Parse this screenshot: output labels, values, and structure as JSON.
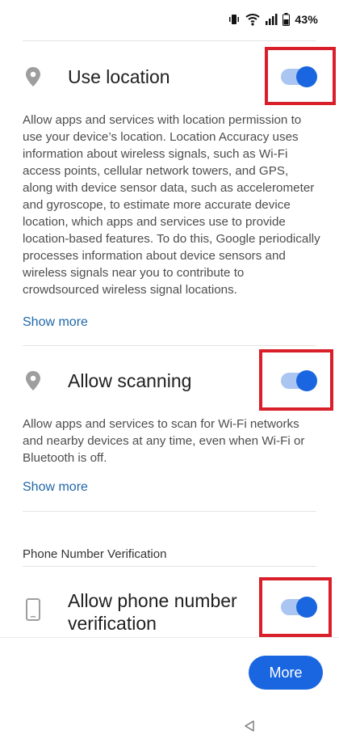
{
  "status_bar": {
    "battery_percent": "43%"
  },
  "use_location": {
    "title": "Use location",
    "description": "Allow apps and services with location permission to use your device’s location. Location Accuracy uses information about wireless signals, such as Wi-Fi access points, cellular network towers, and GPS, along with device sensor data, such as accelerometer and gyroscope, to estimate more accurate device location, which apps and services use to provide location-based features. To do this, Google periodically processes information about device sensors and wireless signals near you to contribute to crowdsourced wireless signal locations.",
    "show_more": "Show more",
    "enabled": true
  },
  "allow_scanning": {
    "title": "Allow scanning",
    "description": "Allow apps and services to scan for Wi-Fi networks and nearby devices at any time, even when Wi-Fi or Bluetooth is off.",
    "show_more": "Show more",
    "enabled": true
  },
  "phone_verification": {
    "section_header": "Phone Number Verification",
    "title_line1": "Allow phone number",
    "title_line2": "verification",
    "enabled": true
  },
  "footer": {
    "more_label": "More"
  },
  "colors": {
    "accent": "#1a66e0",
    "highlight": "#d81f2a",
    "link": "#1f67a8"
  },
  "icons": [
    "vibrate-icon",
    "wifi-icon",
    "signal-icon",
    "battery-icon",
    "location-pin-icon",
    "phone-icon",
    "nav-back-icon"
  ]
}
